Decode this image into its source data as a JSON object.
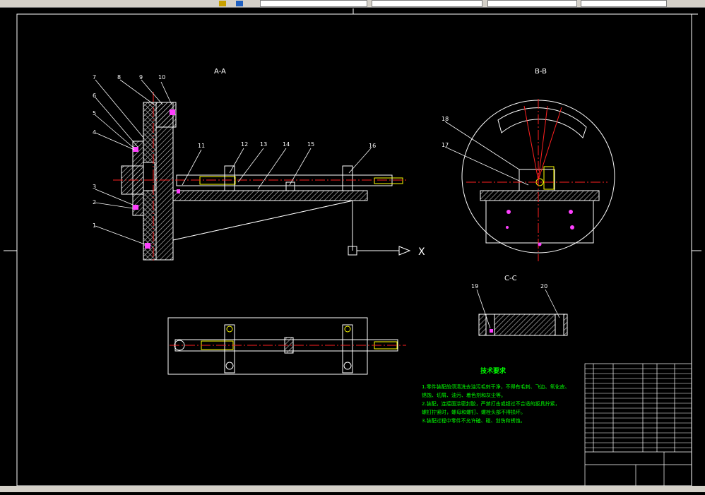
{
  "section_labels": {
    "aa": "A-A",
    "bb": "B-B",
    "cc": "C-C"
  },
  "axis_label_x": "X",
  "part_numbers": [
    "1",
    "2",
    "3",
    "4",
    "5",
    "6",
    "7",
    "8",
    "9",
    "10",
    "11",
    "12",
    "13",
    "14",
    "15",
    "16",
    "17",
    "18",
    "19",
    "20"
  ],
  "tech_req": {
    "title": "技术要求",
    "lines": [
      "1.零件装配前须清洗去油污毛刺干净，不得有毛刺、飞边、氧化皮、",
      "锈蚀、切屑、油污、着色剂和灰尘等。",
      "2.装配，连接面涂密封胶，严禁打击或超过不合适的扳具拧紧，",
      "螺钉拧紧时，螺母和螺钉、螺栓头部不得损坏。",
      "3.装配过程中零件不允许磕、碰、划伤和锈蚀。"
    ]
  },
  "colors": {
    "line": "#ffffff",
    "center": "#ff2020",
    "hatch": "#c8c8c8",
    "shaft": "#ffff00",
    "pink": "#ff40ff",
    "text_green": "#00ff00"
  },
  "status": {
    "text": ""
  }
}
